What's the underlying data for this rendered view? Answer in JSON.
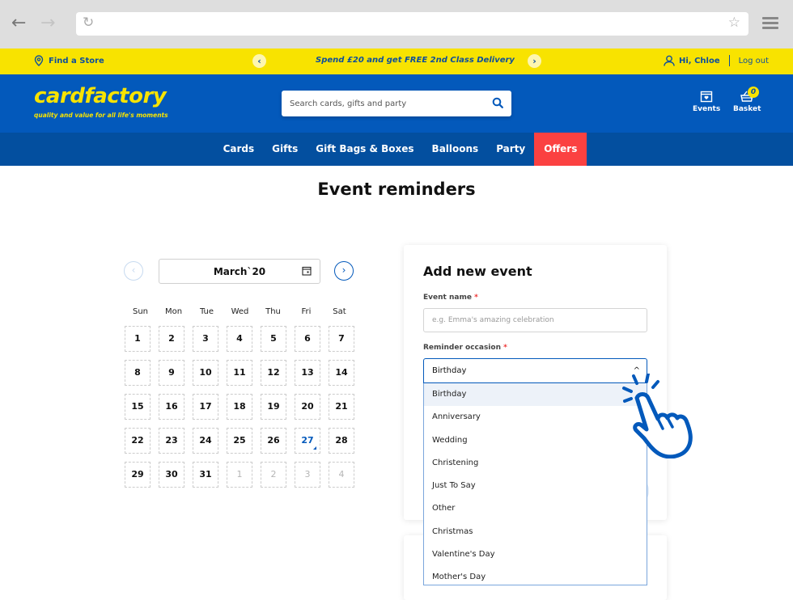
{
  "browser": {
    "back_icon": "arrow-left-icon",
    "forward_icon": "arrow-right-icon",
    "reload_icon": "reload-icon",
    "bookmark_icon": "star-icon",
    "menu_icon": "hamburger-menu-icon",
    "url": ""
  },
  "topbar": {
    "find_store": "Find a Store",
    "promo": "Spend £20 and get FREE 2nd Class Delivery",
    "greeting": "Hi, Chloe",
    "logout": "Log out",
    "prev_glyph": "‹",
    "next_glyph": "›"
  },
  "header": {
    "logo": "cardfactory",
    "tagline": "quality and value for all life's moments",
    "search_placeholder": "Search cards, gifts and party",
    "events_label": "Events",
    "basket_label": "Basket",
    "basket_count": "0"
  },
  "nav": {
    "items": [
      "Cards",
      "Gifts",
      "Gift Bags & Boxes",
      "Balloons",
      "Party",
      "Offers"
    ]
  },
  "page": {
    "title": "Event reminders"
  },
  "calendar": {
    "month_label": "March`20",
    "prev_glyph": "‹",
    "next_glyph": "›",
    "weekdays": [
      "Sun",
      "Mon",
      "Tue",
      "Wed",
      "Thu",
      "Fri",
      "Sat"
    ],
    "days": [
      "1",
      "2",
      "3",
      "4",
      "5",
      "6",
      "7",
      "8",
      "9",
      "10",
      "11",
      "12",
      "13",
      "14",
      "15",
      "16",
      "17",
      "18",
      "19",
      "20",
      "21",
      "22",
      "23",
      "24",
      "25",
      "26",
      "27",
      "28",
      "29",
      "30",
      "31",
      "1",
      "2",
      "3",
      "4"
    ],
    "today": "27",
    "next_month_days_count": 4
  },
  "form": {
    "title": "Add new event",
    "event_name_label": "Event name",
    "required_mark": "*",
    "event_name_placeholder": "e.g. Emma's amazing celebration",
    "event_name_value": "",
    "occasion_label": "Reminder occasion",
    "occasion_selected": "Birthday",
    "chevron": "^",
    "occasion_options": [
      "Birthday",
      "Anniversary",
      "Wedding",
      "Christening",
      "Just To Say",
      "Other",
      "Christmas",
      "Valentine's Day",
      "Mother's Day"
    ]
  },
  "colors": {
    "brand_blue": "#0359bb",
    "nav_blue": "#034f9f",
    "brand_yellow": "#f8e300",
    "offers_red": "#fb4141"
  }
}
